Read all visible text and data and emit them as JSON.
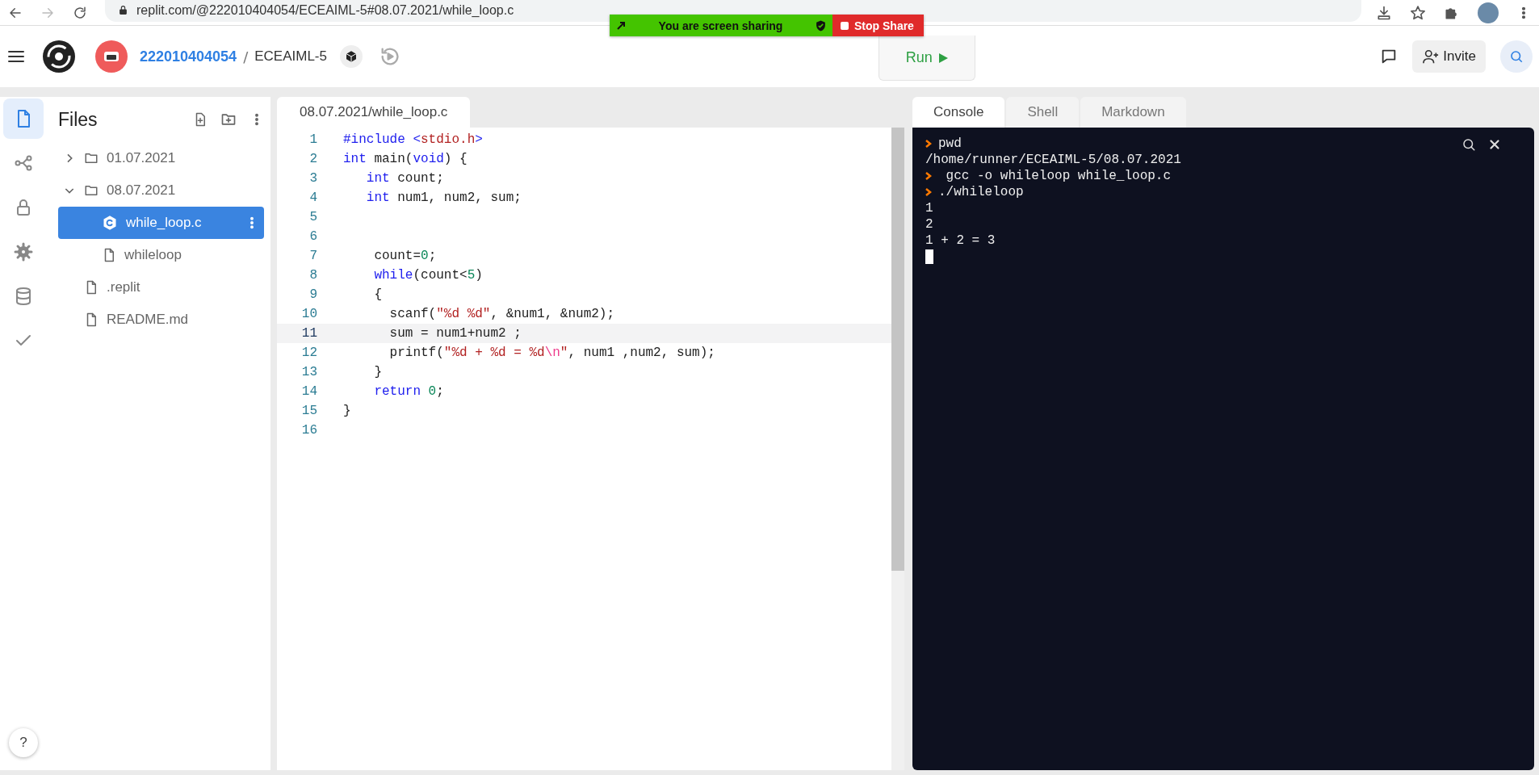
{
  "browser": {
    "url": "replit.com/@222010404054/ECEAIML-5#08.07.2021/while_loop.c"
  },
  "share_banner": {
    "message": "You are screen sharing",
    "stop_label": "Stop Share"
  },
  "header": {
    "user": "222010404054",
    "separator": "/",
    "repl": "ECEAIML-5",
    "run_label": "Run",
    "invite_label": "Invite"
  },
  "rail": [
    {
      "kind": "files",
      "selected": true
    },
    {
      "kind": "share",
      "selected": false
    },
    {
      "kind": "lock",
      "selected": false
    },
    {
      "kind": "settings",
      "selected": false
    },
    {
      "kind": "database",
      "selected": false
    },
    {
      "kind": "check",
      "selected": false
    }
  ],
  "help_label": "?",
  "files": {
    "title": "Files",
    "tree": [
      {
        "kind": "folder",
        "label": "01.07.2021",
        "expanded": false,
        "selected": false
      },
      {
        "kind": "folder",
        "label": "08.07.2021",
        "expanded": true,
        "selected": false,
        "children": [
          {
            "kind": "c-source",
            "label": "while_loop.c",
            "selected": true
          },
          {
            "kind": "file",
            "label": "whileloop",
            "selected": false
          }
        ]
      },
      {
        "kind": "file",
        "label": ".replit",
        "selected": false
      },
      {
        "kind": "file",
        "label": "README.md",
        "selected": false
      }
    ]
  },
  "editor": {
    "tab": "08.07.2021/while_loop.c",
    "lines": [
      {
        "number": "1",
        "current": false,
        "tokens": [
          {
            "kind": "keyword",
            "text": "#include <"
          },
          {
            "kind": "string",
            "text": "stdio.h"
          },
          {
            "kind": "keyword",
            "text": ">"
          }
        ]
      },
      {
        "number": "2",
        "current": false,
        "tokens": [
          {
            "kind": "keyword",
            "text": "int"
          },
          {
            "kind": "plain",
            "text": " main("
          },
          {
            "kind": "keyword",
            "text": "void"
          },
          {
            "kind": "plain",
            "text": ") {"
          }
        ]
      },
      {
        "number": "3",
        "current": false,
        "tokens": [
          {
            "kind": "keyword",
            "text": "   int"
          },
          {
            "kind": "plain",
            "text": " count;"
          }
        ]
      },
      {
        "number": "4",
        "current": false,
        "tokens": [
          {
            "kind": "keyword",
            "text": "   int"
          },
          {
            "kind": "plain",
            "text": " num1, num2, sum;"
          }
        ]
      },
      {
        "number": "5",
        "current": false
      },
      {
        "number": "6",
        "current": false
      },
      {
        "number": "7",
        "current": false,
        "tokens": [
          {
            "kind": "plain",
            "text": "    count="
          },
          {
            "kind": "number",
            "text": "0"
          },
          {
            "kind": "plain",
            "text": ";"
          }
        ]
      },
      {
        "number": "8",
        "current": false,
        "tokens": [
          {
            "kind": "keyword",
            "text": "    while"
          },
          {
            "kind": "plain",
            "text": "(count<"
          },
          {
            "kind": "number",
            "text": "5"
          },
          {
            "kind": "plain",
            "text": ")"
          }
        ]
      },
      {
        "number": "9",
        "current": false,
        "tokens": [
          {
            "kind": "plain",
            "text": "    {"
          }
        ]
      },
      {
        "number": "10",
        "current": false,
        "tokens": [
          {
            "kind": "plain",
            "text": "      scanf("
          },
          {
            "kind": "string",
            "text": "\"%d %d\""
          },
          {
            "kind": "plain",
            "text": ", &num1, &num2);"
          }
        ]
      },
      {
        "number": "11",
        "current": true,
        "tokens": [
          {
            "kind": "plain",
            "text": "      sum = num1+num2 ;"
          }
        ]
      },
      {
        "number": "12",
        "current": false,
        "tokens": [
          {
            "kind": "plain",
            "text": "      printf("
          },
          {
            "kind": "string",
            "text": "\"%d + %d = %d"
          },
          {
            "kind": "escape",
            "text": "\\n"
          },
          {
            "kind": "string",
            "text": "\""
          },
          {
            "kind": "plain",
            "text": ", num1 ,num2, sum);"
          }
        ]
      },
      {
        "number": "13",
        "current": false,
        "tokens": [
          {
            "kind": "plain",
            "text": "    }"
          }
        ]
      },
      {
        "number": "14",
        "current": false,
        "tokens": [
          {
            "kind": "keyword",
            "text": "    return"
          },
          {
            "kind": "number",
            "text": " 0"
          },
          {
            "kind": "plain",
            "text": ";"
          }
        ]
      },
      {
        "number": "15",
        "current": false,
        "tokens": [
          {
            "kind": "plain",
            "text": "}"
          }
        ]
      },
      {
        "number": "16",
        "current": false
      }
    ]
  },
  "console": {
    "tabs": [
      {
        "label": "Console",
        "selected": true
      },
      {
        "label": "Shell",
        "selected": false
      },
      {
        "label": "Markdown",
        "selected": false
      }
    ],
    "lines": [
      {
        "kind": "prompt",
        "text": "pwd"
      },
      {
        "kind": "output",
        "text": "/home/runner/ECEAIML-5/08.07.2021"
      },
      {
        "kind": "prompt",
        "text": " gcc -o whileloop while_loop.c"
      },
      {
        "kind": "prompt",
        "text": "./whileloop"
      },
      {
        "kind": "output",
        "text": "1"
      },
      {
        "kind": "output",
        "text": "2"
      },
      {
        "kind": "output",
        "text": "1 + 2 = 3"
      },
      {
        "kind": "cursor"
      }
    ]
  }
}
